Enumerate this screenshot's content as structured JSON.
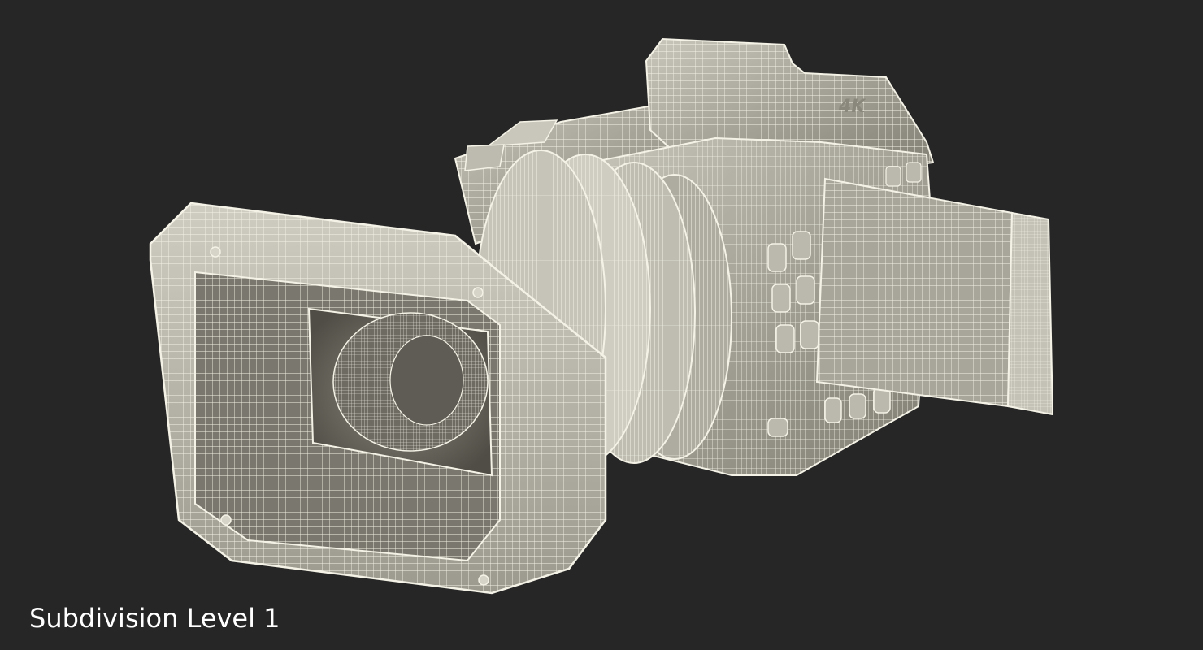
{
  "scene": {
    "background_color": "#262626",
    "model_surface_color": "#d8d6cb",
    "model_shadow_color": "#8d8b80",
    "wire_color": "#f4f2e6"
  },
  "decal": {
    "text": "4K"
  },
  "caption": {
    "text": "Subdivision Level 1"
  }
}
